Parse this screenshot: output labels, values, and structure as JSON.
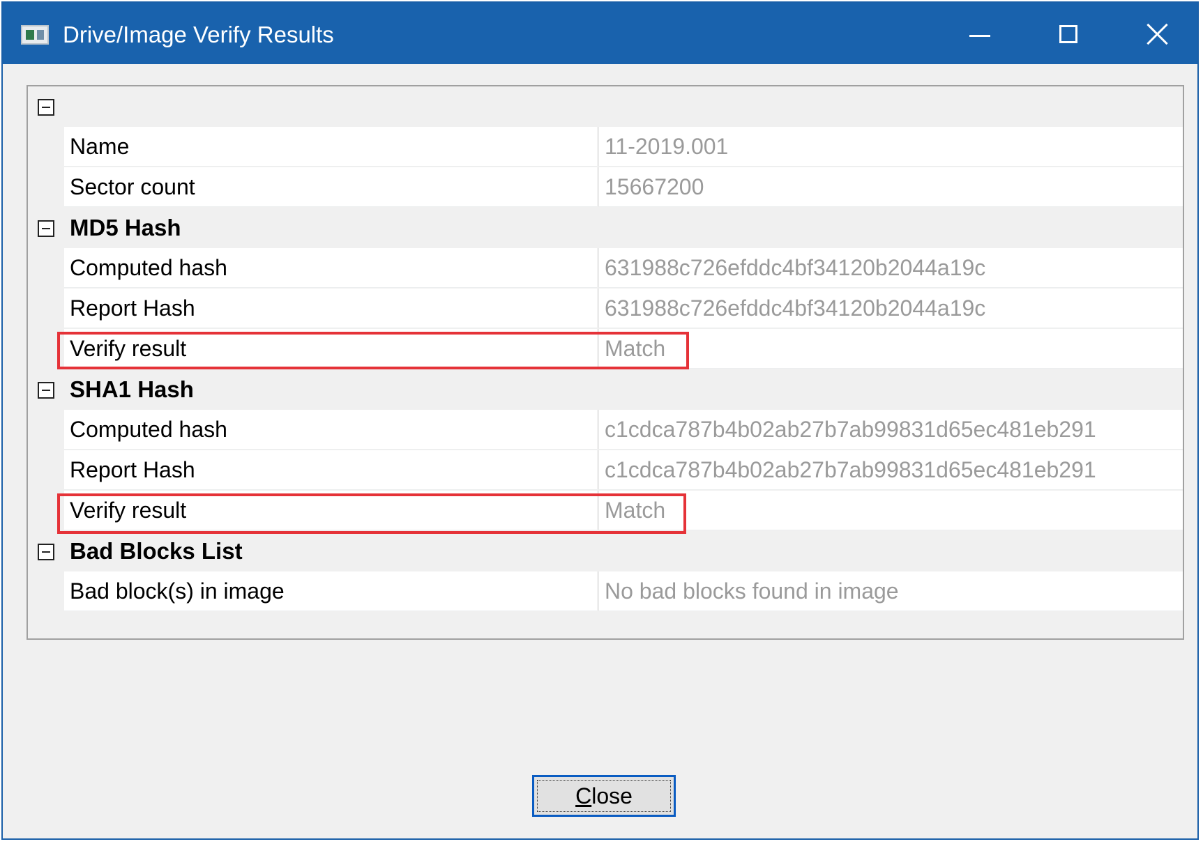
{
  "window": {
    "title": "Drive/Image Verify Results",
    "controls": {
      "minimize": "minimize",
      "maximize": "maximize",
      "close": "close"
    }
  },
  "grid": {
    "top_category": "",
    "image_rows": [
      {
        "label": "Name",
        "value": "11-2019.001"
      },
      {
        "label": "Sector count",
        "value": "15667200"
      }
    ],
    "md5": {
      "header": "MD5 Hash",
      "rows": [
        {
          "label": "Computed hash",
          "value": "631988c726efddc4bf34120b2044a19c"
        },
        {
          "label": "Report Hash",
          "value": "631988c726efddc4bf34120b2044a19c"
        },
        {
          "label": "Verify result",
          "value": "Match"
        }
      ]
    },
    "sha1": {
      "header": "SHA1 Hash",
      "rows": [
        {
          "label": "Computed hash",
          "value": "c1cdca787b4b02ab27b7ab99831d65ec481eb291"
        },
        {
          "label": "Report Hash",
          "value": "c1cdca787b4b02ab27b7ab99831d65ec481eb291"
        },
        {
          "label": "Verify result",
          "value": "Match"
        }
      ]
    },
    "bad_blocks": {
      "header": "Bad Blocks List",
      "rows": [
        {
          "label": "Bad block(s) in image",
          "value": "No bad blocks found in image"
        }
      ]
    }
  },
  "footer": {
    "close_button": {
      "mnemonic": "C",
      "rest": "lose"
    }
  },
  "colors": {
    "titlebar": "#1962ad",
    "highlight": "#e53238",
    "value_text": "#9a9a9a",
    "button_focus_border": "#0a5cc2"
  },
  "icons": {
    "app": "app-window-icon",
    "expander": "collapse-minus-icon"
  }
}
